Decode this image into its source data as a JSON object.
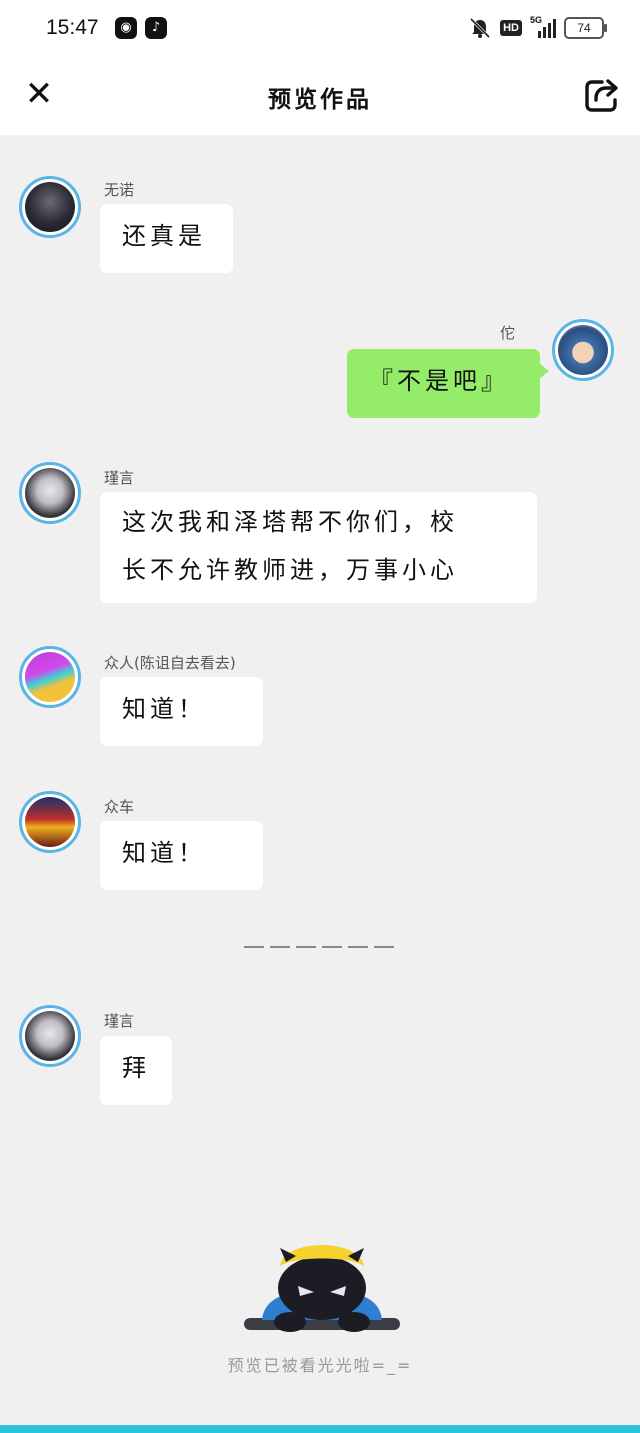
{
  "status_bar": {
    "time": "15:47",
    "apps": [
      "kuaishou-icon",
      "tiktok-icon"
    ],
    "hd": "HD",
    "network": "5G",
    "battery": "74"
  },
  "header": {
    "title": "预览作品",
    "close_icon": "close-icon",
    "share_icon": "share-icon"
  },
  "messages": [
    {
      "side": "left",
      "name": "无诺",
      "text": "还真是",
      "avatar": "dark-hair-girl"
    },
    {
      "side": "right",
      "name": "佗",
      "text": "『不是吧』",
      "avatar": "anime-boy"
    },
    {
      "side": "left",
      "name": "瑾言",
      "lines": [
        "这次我和泽塔帮不你们，校",
        "长不允许教师进，万事小心"
      ],
      "avatar": "anime-girl"
    },
    {
      "side": "left",
      "name": "众人(陈诅自去看去)",
      "text": "知道！",
      "avatar": "colorful-gradient"
    },
    {
      "side": "left",
      "name": "众车",
      "text": "知道！",
      "avatar": "game-logo"
    },
    {
      "side": "left",
      "name": "瑾言",
      "text": "拜",
      "avatar": "anime-girl"
    }
  ],
  "footer": {
    "text": "预览已被看光光啦=_="
  },
  "colors": {
    "accent_bubble": "#95ec69",
    "avatar_ring": "#5ab4e6",
    "bottom_bar": "#2bc4d9"
  }
}
